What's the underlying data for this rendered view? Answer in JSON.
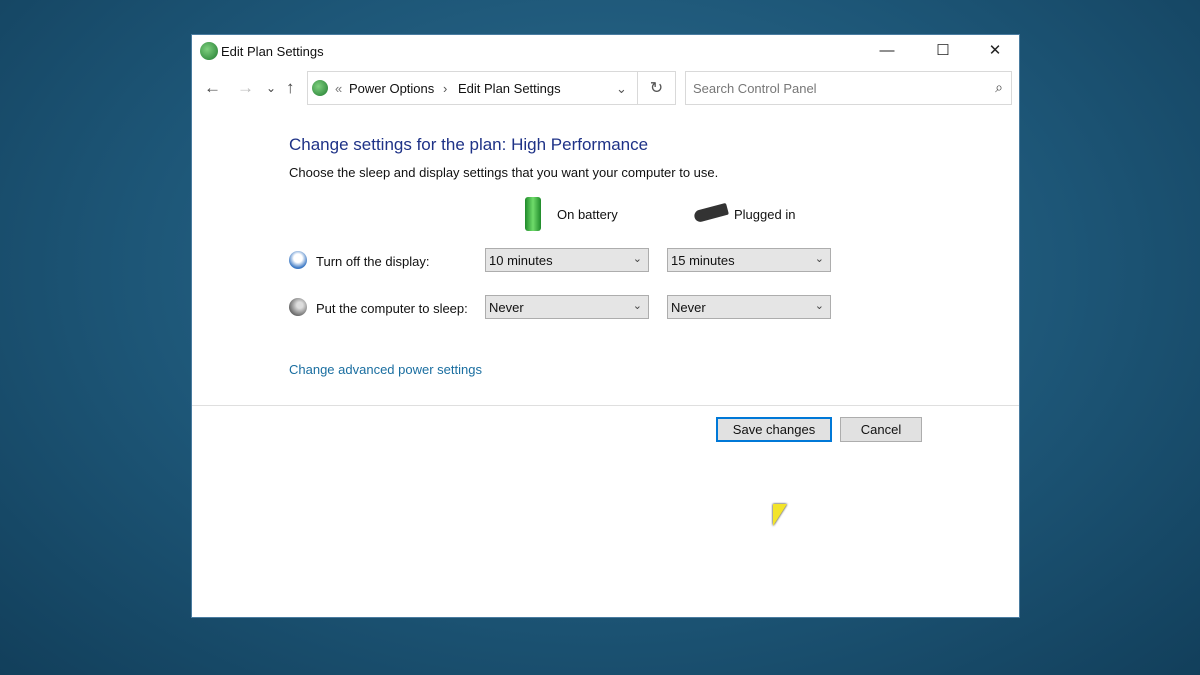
{
  "window": {
    "title": "Edit Plan Settings",
    "minimize": "—",
    "maximize": "☐",
    "close": "✕"
  },
  "nav": {
    "back": "←",
    "forward": "→",
    "recent": "⌄",
    "up": "↑",
    "refresh": "↻"
  },
  "address": {
    "overflow": "«",
    "crumbs": [
      "Power Options",
      "Edit Plan Settings"
    ],
    "separator": "›",
    "dropdown": "⌄"
  },
  "search": {
    "placeholder": "Search Control Panel",
    "icon": "⌕"
  },
  "main": {
    "heading": "Change settings for the plan: High Performance",
    "subtitle": "Choose the sleep and display settings that you want your computer to use.",
    "columns": [
      "On battery",
      "Plugged in"
    ],
    "rows": [
      {
        "label": "Turn off the display:",
        "battery": "10 minutes",
        "plugged": "15 minutes"
      },
      {
        "label": "Put the computer to sleep:",
        "battery": "Never",
        "plugged": "Never"
      }
    ],
    "advanced_link": "Change advanced power settings",
    "chevron": "⌄"
  },
  "buttons": {
    "save": "Save changes",
    "cancel": "Cancel"
  }
}
